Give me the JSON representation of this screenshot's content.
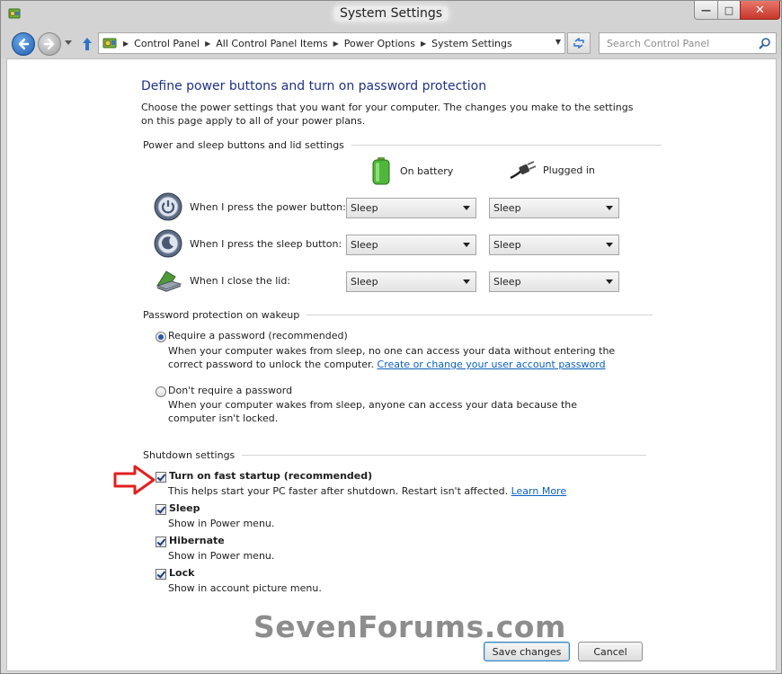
{
  "window": {
    "title": "System Settings",
    "min_glyph": "—",
    "max_glyph": "□",
    "close_glyph": "✕"
  },
  "nav": {
    "breadcrumbs": [
      "Control Panel",
      "All Control Panel Items",
      "Power Options",
      "System Settings"
    ],
    "search_placeholder": "Search Control Panel"
  },
  "page": {
    "title": "Define power buttons and turn on password protection",
    "description": "Choose the power settings that you want for your computer. The changes you make to the settings on this page apply to all of your power plans."
  },
  "buttons_section": {
    "header": "Power and sleep buttons and lid settings",
    "col_battery": "On battery",
    "col_plugged": "Plugged in",
    "rows": [
      {
        "label": "When I press the power button:",
        "battery": "Sleep",
        "plugged": "Sleep"
      },
      {
        "label": "When I press the sleep button:",
        "battery": "Sleep",
        "plugged": "Sleep"
      },
      {
        "label": "When I close the lid:",
        "battery": "Sleep",
        "plugged": "Sleep"
      }
    ]
  },
  "password_section": {
    "header": "Password protection on wakeup",
    "require": {
      "label": "Require a password (recommended)",
      "desc": "When your computer wakes from sleep, no one can access your data without entering the correct password to unlock the computer.",
      "link": "Create or change your user account password",
      "selected": true
    },
    "dont_require": {
      "label": "Don't require a password",
      "desc": "When your computer wakes from sleep, anyone can access your data because the computer isn't locked.",
      "selected": false
    }
  },
  "shutdown_section": {
    "header": "Shutdown settings",
    "items": [
      {
        "label": "Turn on fast startup (recommended)",
        "desc": "This helps start your PC faster after shutdown. Restart isn't affected.",
        "link": "Learn More",
        "checked": true
      },
      {
        "label": "Sleep",
        "desc": "Show in Power menu.",
        "checked": true
      },
      {
        "label": "Hibernate",
        "desc": "Show in Power menu.",
        "checked": true
      },
      {
        "label": "Lock",
        "desc": "Show in account picture menu.",
        "checked": true
      }
    ]
  },
  "watermark": "SevenForums.com",
  "footer": {
    "save": "Save changes",
    "cancel": "Cancel"
  },
  "colors": {
    "title_blue": "#1e3287",
    "link_blue": "#0b5fbf",
    "arrow_red": "#e02020"
  }
}
